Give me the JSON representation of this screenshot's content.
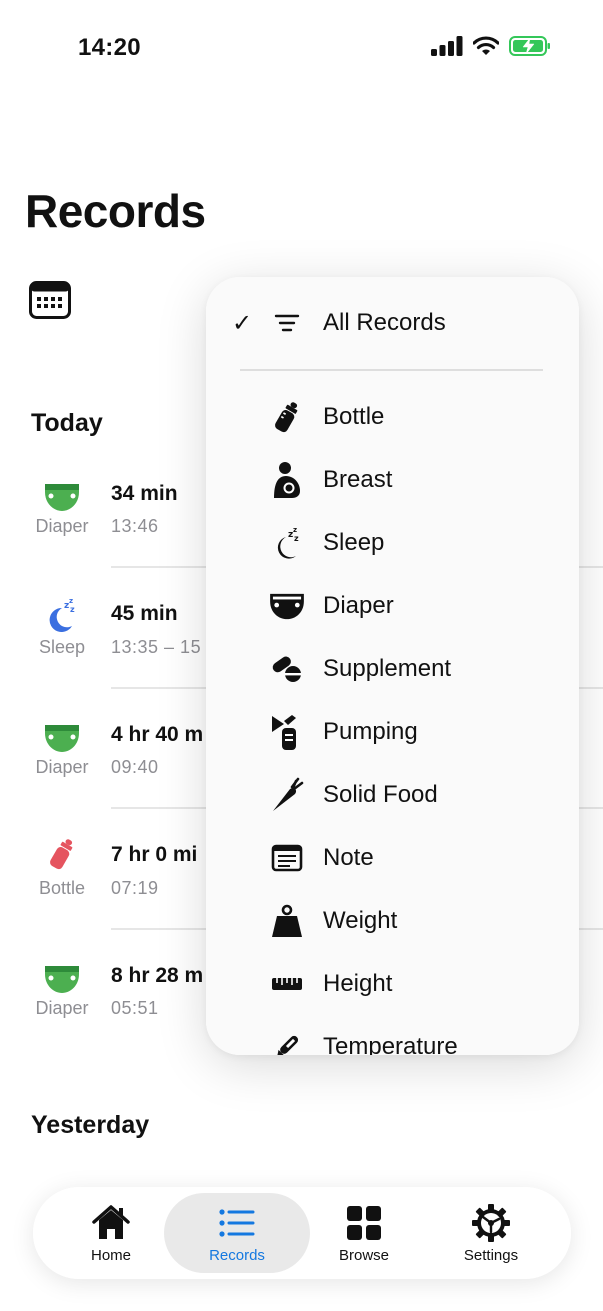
{
  "status_bar": {
    "time": "14:20"
  },
  "page": {
    "title": "Records"
  },
  "sections": {
    "today": "Today",
    "yesterday": "Yesterday"
  },
  "records": [
    {
      "label": "Diaper",
      "duration": "34 min",
      "time": "13:46",
      "icon": "diaper-icon",
      "color": "#4caf50"
    },
    {
      "label": "Sleep",
      "duration": "45 min",
      "time": "13:35 – 15",
      "icon": "sleep-icon",
      "color": "#3b6fe0"
    },
    {
      "label": "Diaper",
      "duration": "4 hr 40 m",
      "time": "09:40",
      "icon": "diaper-icon",
      "color": "#4caf50"
    },
    {
      "label": "Bottle",
      "duration": "7 hr 0 mi",
      "time": "07:19",
      "icon": "bottle-icon",
      "color": "#e5545f"
    },
    {
      "label": "Diaper",
      "duration": "8 hr 28 m",
      "time": "05:51",
      "icon": "diaper-icon",
      "color": "#4caf50"
    }
  ],
  "menu": {
    "selected": "All Records",
    "items": [
      {
        "label": "All Records",
        "icon": "filter-lines-icon",
        "checked": true
      },
      {
        "label": "Bottle",
        "icon": "bottle-icon"
      },
      {
        "label": "Breast",
        "icon": "breastfeeding-icon"
      },
      {
        "label": "Sleep",
        "icon": "sleep-icon"
      },
      {
        "label": "Diaper",
        "icon": "diaper-icon"
      },
      {
        "label": "Supplement",
        "icon": "pills-icon"
      },
      {
        "label": "Pumping",
        "icon": "breast-pump-icon"
      },
      {
        "label": "Solid Food",
        "icon": "carrot-icon"
      },
      {
        "label": "Note",
        "icon": "note-icon"
      },
      {
        "label": "Weight",
        "icon": "weight-icon"
      },
      {
        "label": "Height",
        "icon": "ruler-icon"
      },
      {
        "label": "Temperature",
        "icon": "thermometer-icon"
      }
    ],
    "check_glyph": "✓"
  },
  "tabs": [
    {
      "label": "Home",
      "icon": "home-icon",
      "active": false
    },
    {
      "label": "Records",
      "icon": "list-icon",
      "active": true
    },
    {
      "label": "Browse",
      "icon": "grid-icon",
      "active": false
    },
    {
      "label": "Settings",
      "icon": "gear-icon",
      "active": false
    }
  ],
  "colors": {
    "accent": "#1478e0",
    "diaper": "#4caf50",
    "sleep": "#3b6fe0",
    "bottle": "#e5545f",
    "battery": "#34c759"
  }
}
